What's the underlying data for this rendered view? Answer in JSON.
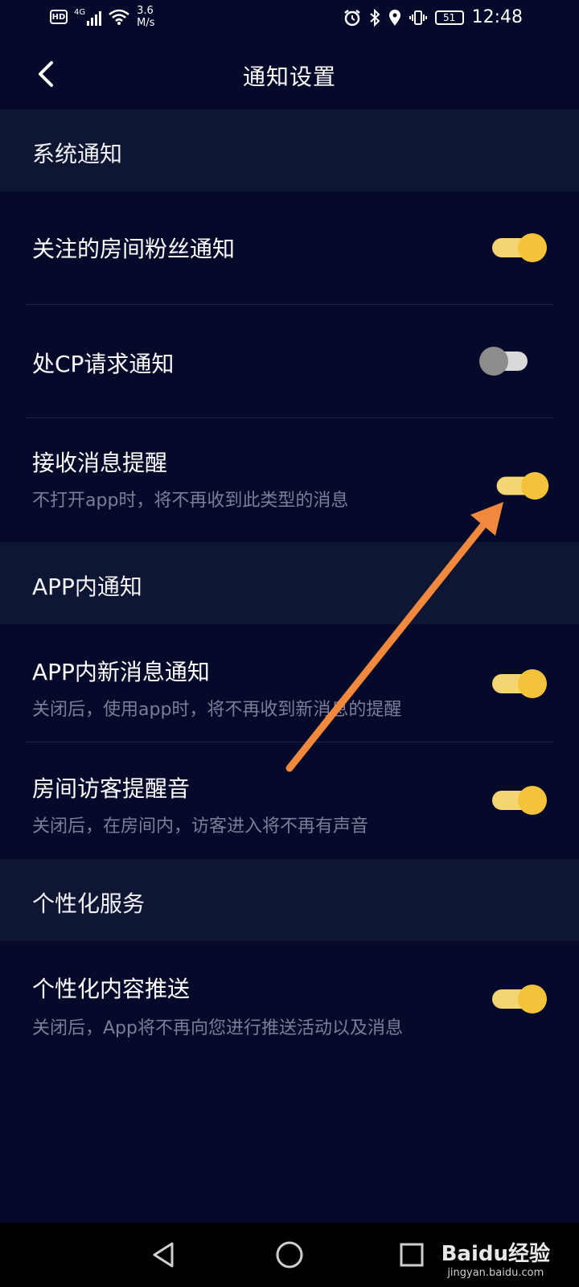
{
  "status_bar": {
    "left_icons": [
      "hd-icon",
      "4g-signal-icon",
      "wifi-icon"
    ],
    "hd": "HD",
    "net": "4G",
    "speed_value": "3.6",
    "speed_unit": "M/s",
    "battery": "51",
    "time": "12:48",
    "right_icons": [
      "alarm-icon",
      "bluetooth-icon",
      "location-icon",
      "vibrate-icon",
      "battery-icon"
    ]
  },
  "header": {
    "title": "通知设置",
    "back_icon": "chevron-left-icon"
  },
  "sections": [
    {
      "title": "系统通知",
      "items": [
        {
          "label": "关注的房间粉丝通知",
          "subtitle": "",
          "toggle": "on"
        },
        {
          "label": "处CP请求通知",
          "subtitle": "",
          "toggle": "off"
        },
        {
          "label": "接收消息提醒",
          "subtitle": "不打开app时，将不再收到此类型的消息",
          "toggle": "on"
        }
      ]
    },
    {
      "title": "APP内通知",
      "items": [
        {
          "label": "APP内新消息通知",
          "subtitle": "关闭后，使用app时，将不再收到新消息的提醒",
          "toggle": "on"
        },
        {
          "label": "房间访客提醒音",
          "subtitle": "关闭后，在房间内，访客进入将不再有声音",
          "toggle": "on"
        }
      ]
    },
    {
      "title": "个性化服务",
      "items": [
        {
          "label": "个性化内容推送",
          "subtitle": "关闭后，App将不再向您进行推送活动以及消息",
          "toggle": "on"
        }
      ]
    }
  ],
  "annotation": {
    "color": "#f0883e",
    "description": "arrow pointing to toggle"
  },
  "navbar": {
    "icons": [
      "back-triangle-icon",
      "home-circle-icon",
      "recents-square-icon"
    ]
  },
  "watermark": {
    "logo": "Baidu经验",
    "sub": "jingyan.baidu.com"
  },
  "colors": {
    "background": "#050a2a",
    "section": "#0f1634",
    "toggle_on": "#f5c23c",
    "toggle_off": "#8c8c8c"
  }
}
